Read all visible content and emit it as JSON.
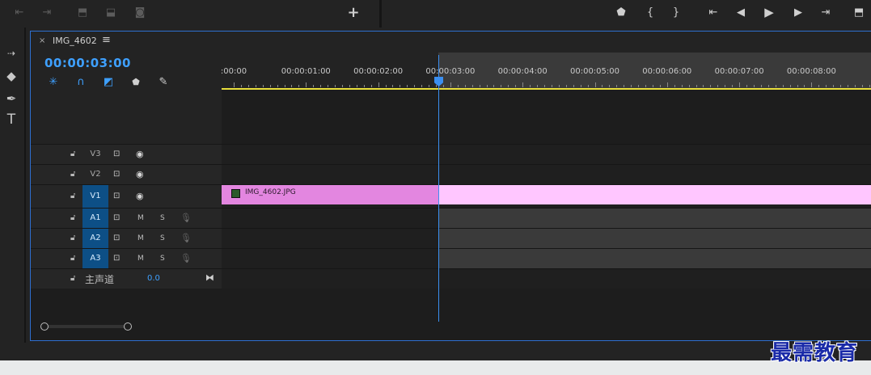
{
  "window": {
    "tab_close": "×",
    "tab_title": "IMG_4602",
    "tab_menu": "≡"
  },
  "timecode": "00:00:03:00",
  "toolbar": {
    "add_button": "+",
    "left_icons": [
      "go-to-in-icon",
      "go-to-out-icon",
      "lift-icon",
      "extract-icon",
      "export-frame-icon"
    ],
    "right_icons": [
      "marker-icon",
      "mark-in-icon",
      "mark-out-icon",
      "go-to-in-icon",
      "step-back-icon",
      "play-icon",
      "step-forward-icon",
      "go-to-out-icon",
      "insert-icon"
    ]
  },
  "tools": [
    "track-select-icon",
    "razor-icon",
    "pen-icon",
    "type-icon"
  ],
  "ruler": {
    "labels": [
      ":00:00",
      "00:00:01:00",
      "00:00:02:00",
      "00:00:03:00",
      "00:00:04:00",
      "00:00:05:00",
      "00:00:06:00",
      "00:00:07:00",
      "00:00:08:00",
      "00:0"
    ]
  },
  "tracks": {
    "video": [
      {
        "name": "V3",
        "active": false
      },
      {
        "name": "V2",
        "active": false
      },
      {
        "name": "V1",
        "active": true
      }
    ],
    "audio": [
      {
        "name": "A1",
        "m": "M",
        "s": "S"
      },
      {
        "name": "A2",
        "m": "M",
        "s": "S"
      },
      {
        "name": "A3",
        "m": "M",
        "s": "S"
      }
    ],
    "master": {
      "name": "主声道",
      "value": "0.0"
    }
  },
  "clip": {
    "name": "IMG_4602.JPG"
  },
  "colors": {
    "accent": "#3ea0ff",
    "clip_selected": "#e386e0",
    "clip_tail": "#ffc6ff",
    "work_area": "#e8df3c",
    "active_track": "#0d4f86"
  },
  "watermark": "最需教育"
}
